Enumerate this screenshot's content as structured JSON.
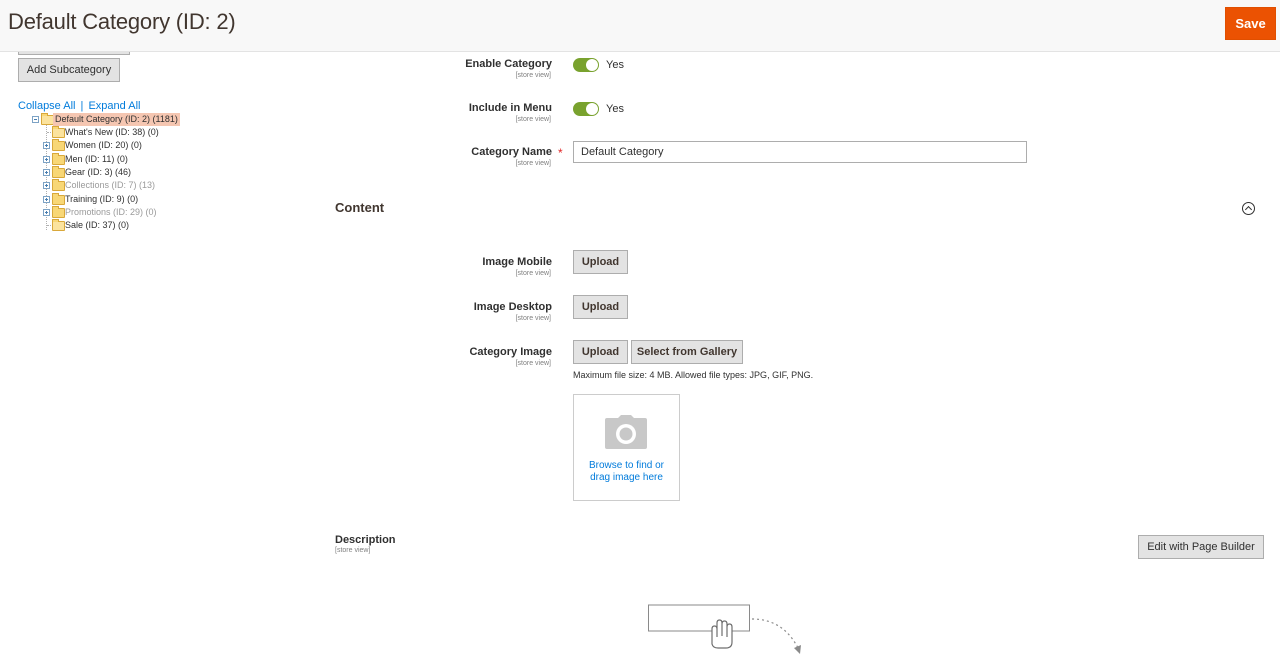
{
  "header": {
    "title": "Default Category (ID: 2)",
    "save_label": "Save"
  },
  "tree": {
    "add_subcategory_label": "Add Subcategory",
    "collapse_all": "Collapse All",
    "separator": "|",
    "expand_all": "Expand All",
    "root": {
      "label": "Default Category (ID: 2) (1181)"
    },
    "children": [
      {
        "label": "What's New (ID: 38) (0)",
        "expandable": false,
        "enabled": true
      },
      {
        "label": "Women (ID: 20) (0)",
        "expandable": true,
        "enabled": true
      },
      {
        "label": "Men (ID: 11) (0)",
        "expandable": true,
        "enabled": true
      },
      {
        "label": "Gear (ID: 3) (46)",
        "expandable": true,
        "enabled": true
      },
      {
        "label": "Collections (ID: 7) (13)",
        "expandable": true,
        "enabled": false
      },
      {
        "label": "Training (ID: 9) (0)",
        "expandable": true,
        "enabled": true
      },
      {
        "label": "Promotions (ID: 29) (0)",
        "expandable": true,
        "enabled": false
      },
      {
        "label": "Sale (ID: 37) (0)",
        "expandable": false,
        "enabled": true
      }
    ]
  },
  "form": {
    "enable_category": {
      "label": "Enable Category",
      "scope": "[store view]",
      "value": "Yes"
    },
    "include_in_menu": {
      "label": "Include in Menu",
      "scope": "[store view]",
      "value": "Yes"
    },
    "category_name": {
      "label": "Category Name",
      "scope": "[store view]",
      "value": "Default Category",
      "required_mark": "*"
    }
  },
  "content": {
    "title": "Content",
    "image_mobile": {
      "label": "Image Mobile",
      "scope": "[store view]",
      "upload_label": "Upload"
    },
    "image_desktop": {
      "label": "Image Desktop",
      "scope": "[store view]",
      "upload_label": "Upload"
    },
    "category_image": {
      "label": "Category Image",
      "scope": "[store view]",
      "upload_label": "Upload",
      "gallery_label": "Select from Gallery",
      "note": "Maximum file size: 4 MB. Allowed file types: JPG, GIF, PNG.",
      "dropzone_line1": "Browse to find or",
      "dropzone_line2": "drag image here"
    },
    "description": {
      "label": "Description",
      "scope": "[store view]",
      "page_builder_label": "Edit with Page Builder"
    }
  },
  "colors": {
    "accent": "#eb5202",
    "toggle_on": "#79a22e",
    "link": "#007bdb"
  }
}
